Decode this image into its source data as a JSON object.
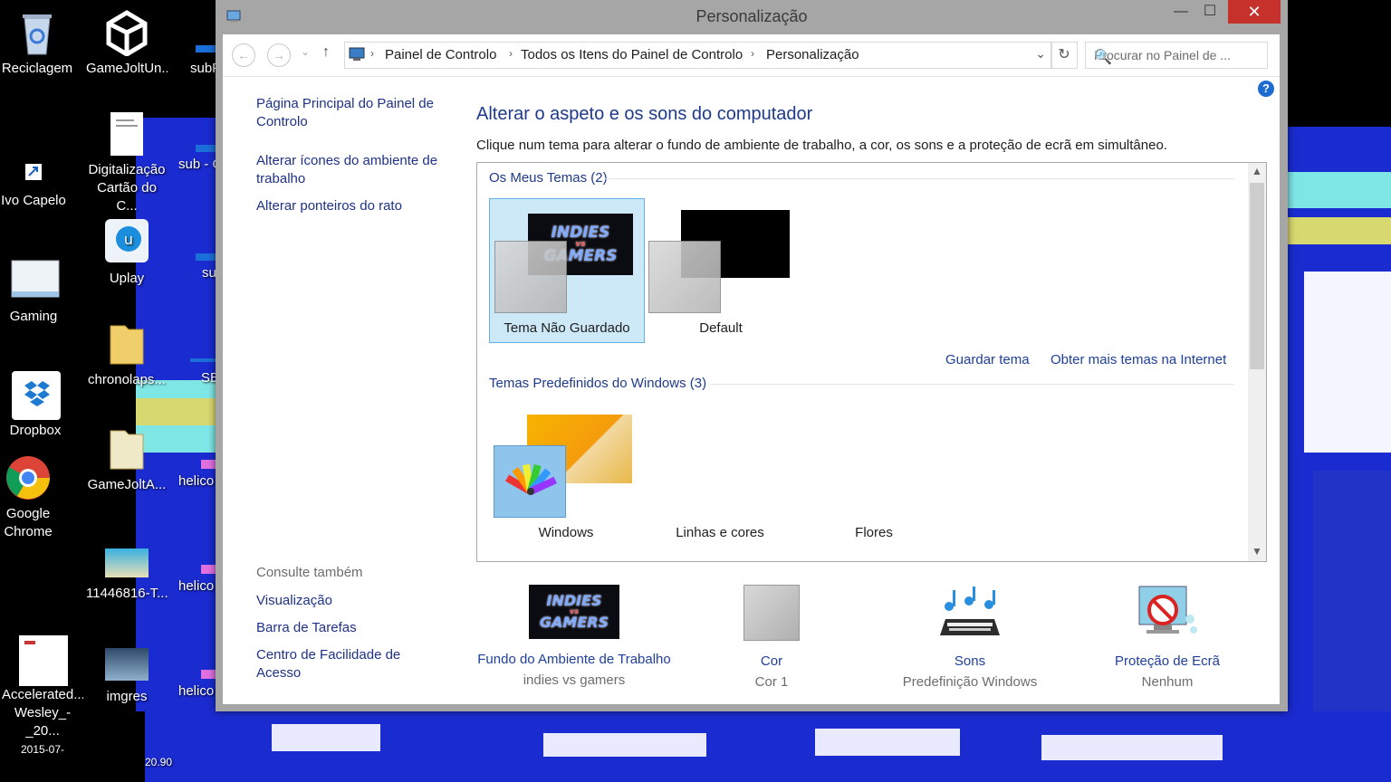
{
  "desktop": {
    "icons": [
      {
        "label": "Reciclagem",
        "icon": "recycle-bin-icon"
      },
      {
        "label": "GameJoltUn...",
        "icon": "unity-icon"
      },
      {
        "label": "subF",
        "icon": "file-icon"
      },
      {
        "label": "Ivo Capelo",
        "icon": "shortcut-icon"
      },
      {
        "label": "Digitalização Cartão do C...",
        "icon": "document-icon"
      },
      {
        "label": "sub - C",
        "icon": "file-icon"
      },
      {
        "label": "Uplay",
        "icon": "uplay-icon"
      },
      {
        "label": "su",
        "icon": "file-icon"
      },
      {
        "label": "Gaming",
        "icon": "window-icon"
      },
      {
        "label": "chronolaps...",
        "icon": "folder-icon"
      },
      {
        "label": "SE",
        "icon": "file-icon"
      },
      {
        "label": "Dropbox",
        "icon": "dropbox-icon"
      },
      {
        "label": "GameJoltA...",
        "icon": "folder-icon"
      },
      {
        "label": "helico",
        "icon": "file-icon"
      },
      {
        "label": "Google Chrome",
        "icon": "chrome-icon"
      },
      {
        "label": "11446816-T...",
        "icon": "image-icon"
      },
      {
        "label": "helico",
        "icon": "file-icon"
      },
      {
        "label": "Accelerated... Wesley_-_20...",
        "icon": "document-icon"
      },
      {
        "label": "imgres",
        "icon": "image-icon"
      },
      {
        "label": "helico",
        "icon": "file-icon"
      },
      {
        "label": "2015-07-",
        "icon": "document-icon"
      },
      {
        "label": "20.90",
        "icon": "file-icon"
      }
    ]
  },
  "window": {
    "title": "Personalização",
    "minimize": "—",
    "maximize": "☐",
    "close": "✕",
    "nav": {
      "back": "←",
      "forward": "→",
      "recent": "⌄",
      "up": "↑",
      "breadcrumbs": [
        "Painel de Controlo",
        "Todos os Itens do Painel de Controlo",
        "Personalização"
      ],
      "separator": "›",
      "dropdown": "⌄",
      "refresh": "↻",
      "search_placeholder": "Procurar no Painel de ...",
      "search_icon": "🔍"
    },
    "left_pane": {
      "links": [
        "Página Principal do Painel de Controlo",
        "Alterar ícones do ambiente de trabalho",
        "Alterar ponteiros do rato"
      ],
      "see_also_heading": "Consulte também",
      "see_also": [
        "Visualização",
        "Barra de Tarefas",
        "Centro de Facilidade de Acesso"
      ]
    },
    "help": "?",
    "main": {
      "title": "Alterar o aspeto e os sons do computador",
      "description": "Clique num tema para alterar o fundo de ambiente de trabalho, a cor, os sons e a proteção de ecrã em simultâneo.",
      "my_themes_heading": "Os Meus Temas (2)",
      "my_themes": [
        {
          "label": "Tema Não Guardado",
          "selected": true
        },
        {
          "label": "Default",
          "selected": false
        }
      ],
      "save_theme": "Guardar tema",
      "more_themes": "Obter mais temas na Internet",
      "windows_themes_heading": "Temas Predefinidos do Windows (3)",
      "windows_themes": [
        {
          "label": "Windows"
        },
        {
          "label": "Linhas e cores"
        },
        {
          "label": "Flores"
        }
      ],
      "scroll_up": "▲",
      "scroll_down": "▼",
      "thumb_logo_line1": "INDIES",
      "thumb_logo_line2": "vs",
      "thumb_logo_line3": "GAMERS"
    },
    "bottom": [
      {
        "link": "Fundo do Ambiente de Trabalho",
        "sub": "indies vs gamers",
        "icon": "wallpaper-icon"
      },
      {
        "link": "Cor",
        "sub": "Cor 1",
        "icon": "color-swatch-icon"
      },
      {
        "link": "Sons",
        "sub": "Predefinição Windows",
        "icon": "sounds-icon"
      },
      {
        "link": "Proteção de Ecrã",
        "sub": "Nenhum",
        "icon": "screensaver-icon"
      }
    ],
    "colors": {
      "link": "#1e3f9a",
      "heading": "#1e3a8a",
      "selection": "#cde8f7",
      "close": "#c7312c"
    }
  }
}
